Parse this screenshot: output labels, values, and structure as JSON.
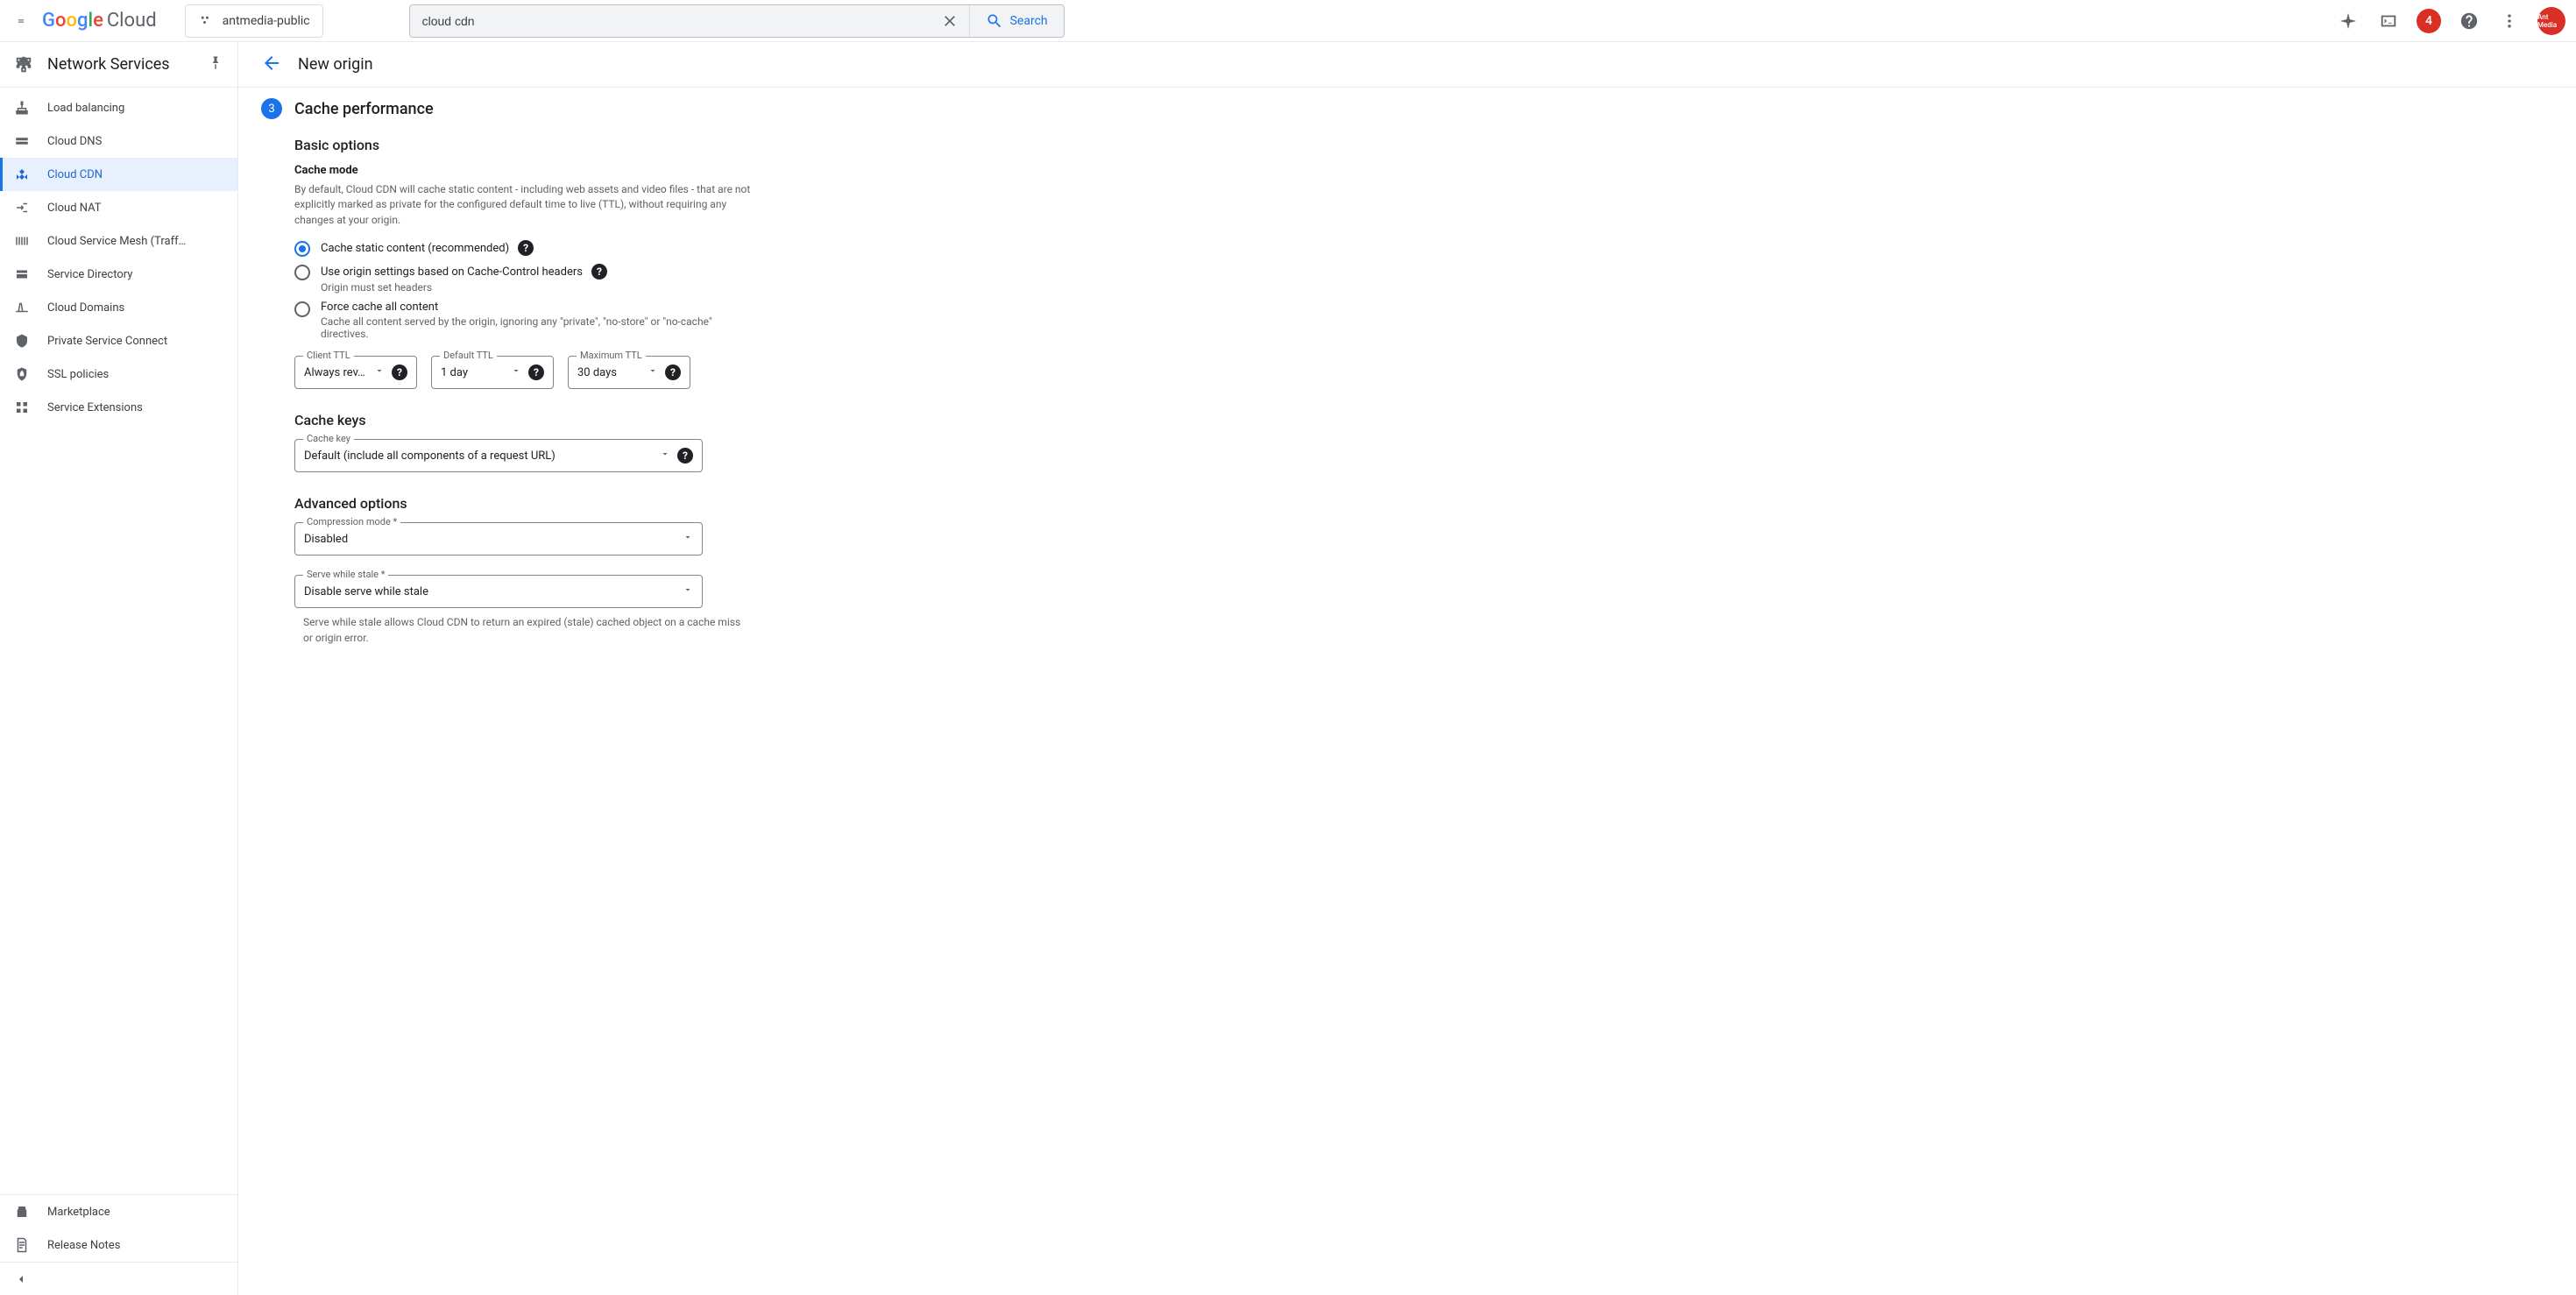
{
  "header": {
    "project": "antmedia-public",
    "search_value": "cloud cdn",
    "search_button": "Search",
    "notification_count": "4",
    "avatar_text": "Ant Media"
  },
  "sidebar": {
    "title": "Network Services",
    "items": [
      {
        "label": "Load balancing"
      },
      {
        "label": "Cloud DNS"
      },
      {
        "label": "Cloud CDN"
      },
      {
        "label": "Cloud NAT"
      },
      {
        "label": "Cloud Service Mesh (Traff…"
      },
      {
        "label": "Service Directory"
      },
      {
        "label": "Cloud Domains"
      },
      {
        "label": "Private Service Connect"
      },
      {
        "label": "SSL policies"
      },
      {
        "label": "Service Extensions"
      }
    ],
    "bottom": [
      {
        "label": "Marketplace"
      },
      {
        "label": "Release Notes"
      }
    ]
  },
  "page": {
    "title": "New origin",
    "step_number": "3",
    "step_title": "Cache performance",
    "basic": {
      "heading": "Basic options",
      "cache_mode_label": "Cache mode",
      "cache_mode_desc": "By default, Cloud CDN will cache static content - including web assets and video files - that are not explicitly marked as private for the configured default time to live (TTL), without requiring any changes at your origin.",
      "options": [
        {
          "label": "Cache static content (recommended)",
          "sub": ""
        },
        {
          "label": "Use origin settings based on Cache-Control headers",
          "sub": "Origin must set headers"
        },
        {
          "label": "Force cache all content",
          "sub": "Cache all content served by the origin, ignoring any \"private\", \"no-store\" or \"no-cache\" directives."
        }
      ],
      "ttl": {
        "client": {
          "label": "Client TTL",
          "value": "Always rev…"
        },
        "default": {
          "label": "Default TTL",
          "value": "1 day"
        },
        "maximum": {
          "label": "Maximum TTL",
          "value": "30 days"
        }
      }
    },
    "cache_keys": {
      "heading": "Cache keys",
      "field_label": "Cache key",
      "value": "Default (include all components of a request URL)"
    },
    "advanced": {
      "heading": "Advanced options",
      "compression": {
        "label": "Compression mode *",
        "value": "Disabled"
      },
      "stale": {
        "label": "Serve while stale *",
        "value": "Disable serve while stale",
        "desc": "Serve while stale allows Cloud CDN to return an expired (stale) cached object on a cache miss or origin error."
      }
    }
  }
}
